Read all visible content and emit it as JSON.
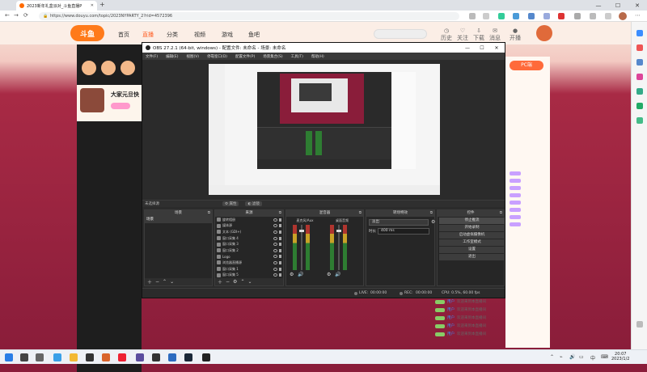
{
  "browser": {
    "tab_title": "2023新年礼盒派对_斗鱼直播P",
    "url": "https://www.douyu.com/topic/2023NYPARTY_2?rid=4572396"
  },
  "site": {
    "logo_text": "斗鱼",
    "nav": [
      "首页",
      "直播",
      "分类",
      "视频",
      "游戏",
      "鱼吧"
    ],
    "header_icons": [
      "历史",
      "关注",
      "下载",
      "消息",
      "开播"
    ],
    "pc_badge": "PC端",
    "streamer_name": "大家元旦快"
  },
  "obs": {
    "title": "OBS 27.2.1 (64-bit, windows) - 配置文件: 未命名 - 场景: 未命名",
    "menu": [
      "文件(F)",
      "编辑(E)",
      "视图(V)",
      "停靠窗口(D)",
      "配置文件(P)",
      "场景集合(S)",
      "工具(T)",
      "帮助(H)"
    ],
    "no_source_selected": "未选择源",
    "props_button": "属性",
    "filters_button": "滤镜",
    "docks": {
      "scenes": "场景",
      "sources": "来源",
      "mixer": "混音器",
      "transitions": "转场特效",
      "controls": "控件"
    },
    "scene_items": [
      "场景"
    ],
    "source_items": [
      "旋转相册",
      "媒体源",
      "文本 (GDI+)",
      "窗口采集 4",
      "窗口采集 3",
      "窗口采集 2",
      "Logo",
      "浏览器直播源",
      "窗口采集 1",
      "窗口采集 5"
    ],
    "mixer_channels": [
      {
        "name": "麦克风/Aux"
      },
      {
        "name": "桌面音频"
      }
    ],
    "transition": {
      "selected": "淡出",
      "duration_label": "时长",
      "duration_value": "400 ms"
    },
    "controls": [
      "停止推流",
      "开始录制",
      "启动虚拟摄像机",
      "工作室模式",
      "设置",
      "退出"
    ],
    "status": {
      "live_label": "LIVE:",
      "live_time": "00:00:00",
      "rec_label": "REC:",
      "rec_time": "00:00:00",
      "cpu": "CPU: 0.5%, 60.00 fps"
    }
  },
  "chat": [
    {
      "name": "用户",
      "text": "欢迎来到本直播间"
    },
    {
      "name": "用户",
      "text": "欢迎来到本直播间"
    },
    {
      "name": "用户",
      "text": "欢迎来到本直播间"
    },
    {
      "name": "用户",
      "text": "欢迎来到本直播间"
    },
    {
      "name": "用户",
      "text": "欢迎来到本直播间"
    }
  ],
  "taskbar": {
    "time": "20:07",
    "date": "2023/1/2"
  }
}
